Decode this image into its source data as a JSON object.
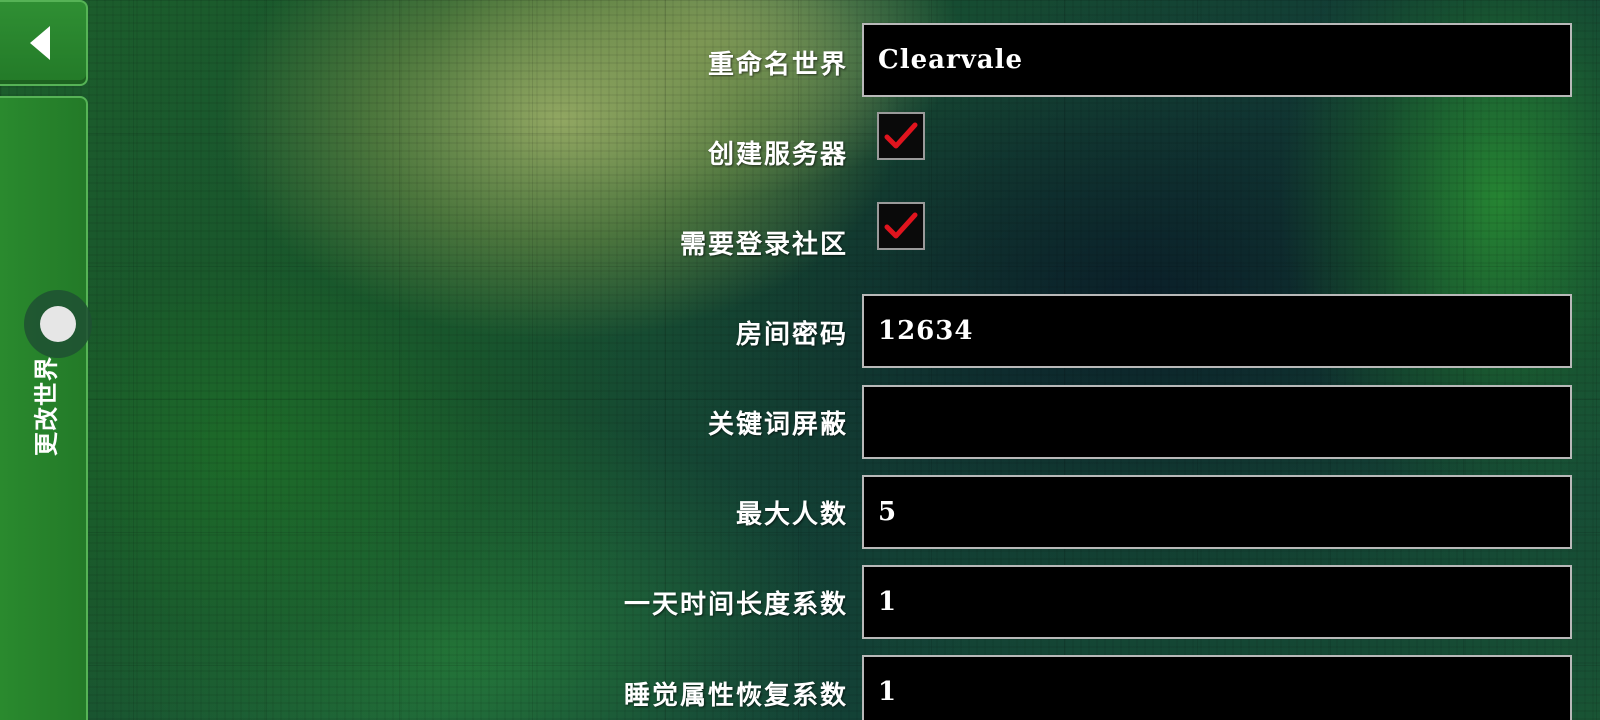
{
  "sidebar": {
    "side_tab_label": "更改世界"
  },
  "form": {
    "rename_world": {
      "label": "重命名世界",
      "value": "Clearvale"
    },
    "create_server": {
      "label": "创建服务器",
      "checked": true
    },
    "require_community_login": {
      "label": "需要登录社区",
      "checked": true
    },
    "room_password": {
      "label": "房间密码",
      "value": "12634"
    },
    "keyword_filter": {
      "label": "关键词屏蔽",
      "value": ""
    },
    "max_players": {
      "label": "最大人数",
      "value": "5"
    },
    "day_length_factor": {
      "label": "一天时间长度系数",
      "value": "1"
    },
    "sleep_recovery_factor": {
      "label": "睡觉属性恢复系数",
      "value": "1"
    }
  },
  "colors": {
    "accent_green": "#2a8a2e",
    "check_red": "#e0141e",
    "field_border": "#b9b9b9"
  }
}
